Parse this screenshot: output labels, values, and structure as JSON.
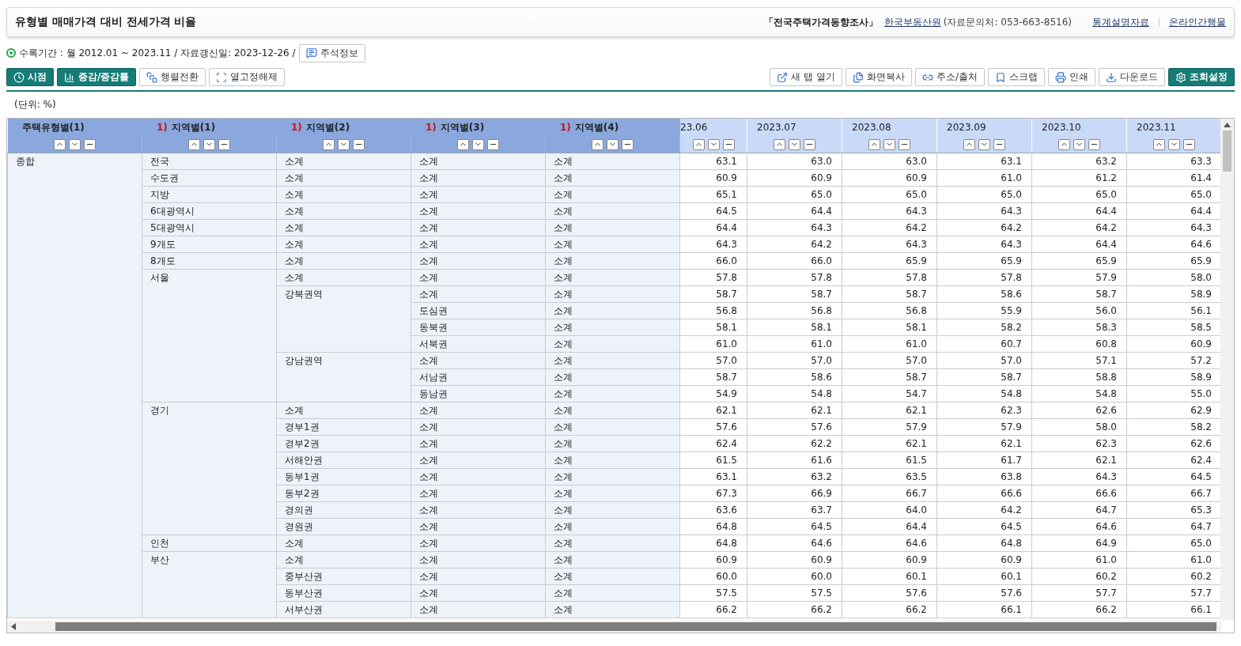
{
  "header": {
    "title": "유형별 매매가격 대비 전세가격 비율",
    "survey": "「전국주택가격동향조사」",
    "agency": "한국부동산원",
    "contact": "(자료문의처: 053-663-8516)",
    "links": [
      "통계설명자료",
      "온라인간행물"
    ]
  },
  "info": {
    "text": "수록기간 : 월 2012.01 ~ 2023.11 / 자료갱신일: 2023-12-26 /",
    "button": "주석정보"
  },
  "toolbar_left": [
    {
      "label": "시점",
      "kind": "primary"
    },
    {
      "label": "증감/증감률",
      "kind": "primary"
    },
    {
      "label": "행렬전환",
      "kind": "plain"
    },
    {
      "label": "열고정해제",
      "kind": "plain"
    }
  ],
  "toolbar_right": [
    {
      "label": "새 탭 열기",
      "kind": "plain"
    },
    {
      "label": "화면복사",
      "kind": "plain"
    },
    {
      "label": "주소/출처",
      "kind": "plain"
    },
    {
      "label": "스크랩",
      "kind": "plain"
    },
    {
      "label": "인쇄",
      "kind": "plain"
    },
    {
      "label": "다운로드",
      "kind": "plain"
    },
    {
      "label": "조회설정",
      "kind": "primary"
    }
  ],
  "unit": "(단위: %)",
  "table": {
    "dim_columns": [
      {
        "label": "주택유형별(1)"
      },
      {
        "mark": "1)",
        "label": "지역별(1)"
      },
      {
        "mark": "1)",
        "label": "지역별(2)"
      },
      {
        "mark": "1)",
        "label": "지역별(3)"
      },
      {
        "mark": "1)",
        "label": "지역별(4)"
      }
    ],
    "value_columns": [
      "23.06",
      "2023.07",
      "2023.08",
      "2023.09",
      "2023.10",
      "2023.11"
    ],
    "groups": [
      {
        "label": "종합",
        "children": [
          {
            "label": "전국",
            "children": [
              {
                "label": "소계",
                "rows": [
                  {
                    "c3": "소계",
                    "c4": "소계",
                    "values": [
                      "63.1",
                      "63.0",
                      "63.0",
                      "63.1",
                      "63.2",
                      "63.3"
                    ]
                  }
                ]
              }
            ]
          },
          {
            "label": "수도권",
            "children": [
              {
                "label": "소계",
                "rows": [
                  {
                    "c3": "소계",
                    "c4": "소계",
                    "values": [
                      "60.9",
                      "60.9",
                      "60.9",
                      "61.0",
                      "61.2",
                      "61.4"
                    ]
                  }
                ]
              }
            ]
          },
          {
            "label": "지방",
            "children": [
              {
                "label": "소계",
                "rows": [
                  {
                    "c3": "소계",
                    "c4": "소계",
                    "values": [
                      "65.1",
                      "65.0",
                      "65.0",
                      "65.0",
                      "65.0",
                      "65.0"
                    ]
                  }
                ]
              }
            ]
          },
          {
            "label": "6대광역시",
            "children": [
              {
                "label": "소계",
                "rows": [
                  {
                    "c3": "소계",
                    "c4": "소계",
                    "values": [
                      "64.5",
                      "64.4",
                      "64.3",
                      "64.3",
                      "64.4",
                      "64.4"
                    ]
                  }
                ]
              }
            ]
          },
          {
            "label": "5대광역시",
            "children": [
              {
                "label": "소계",
                "rows": [
                  {
                    "c3": "소계",
                    "c4": "소계",
                    "values": [
                      "64.4",
                      "64.3",
                      "64.2",
                      "64.2",
                      "64.2",
                      "64.3"
                    ]
                  }
                ]
              }
            ]
          },
          {
            "label": "9개도",
            "children": [
              {
                "label": "소계",
                "rows": [
                  {
                    "c3": "소계",
                    "c4": "소계",
                    "values": [
                      "64.3",
                      "64.2",
                      "64.3",
                      "64.3",
                      "64.4",
                      "64.6"
                    ]
                  }
                ]
              }
            ]
          },
          {
            "label": "8개도",
            "children": [
              {
                "label": "소계",
                "rows": [
                  {
                    "c3": "소계",
                    "c4": "소계",
                    "values": [
                      "66.0",
                      "66.0",
                      "65.9",
                      "65.9",
                      "65.9",
                      "65.9"
                    ]
                  }
                ]
              }
            ]
          },
          {
            "label": "서울",
            "children": [
              {
                "label": "소계",
                "rows": [
                  {
                    "c3": "소계",
                    "c4": "소계",
                    "values": [
                      "57.8",
                      "57.8",
                      "57.8",
                      "57.8",
                      "57.9",
                      "58.0"
                    ]
                  }
                ]
              },
              {
                "label": "강북권역",
                "rows": [
                  {
                    "c3": "소계",
                    "c4": "소계",
                    "values": [
                      "58.7",
                      "58.7",
                      "58.7",
                      "58.6",
                      "58.7",
                      "58.9"
                    ]
                  },
                  {
                    "c3": "도심권",
                    "c4": "소계",
                    "values": [
                      "56.8",
                      "56.8",
                      "56.8",
                      "55.9",
                      "56.0",
                      "56.1"
                    ]
                  },
                  {
                    "c3": "동북권",
                    "c4": "소계",
                    "values": [
                      "58.1",
                      "58.1",
                      "58.1",
                      "58.2",
                      "58.3",
                      "58.5"
                    ]
                  },
                  {
                    "c3": "서북권",
                    "c4": "소계",
                    "values": [
                      "61.0",
                      "61.0",
                      "61.0",
                      "60.7",
                      "60.8",
                      "60.9"
                    ]
                  }
                ]
              },
              {
                "label": "강남권역",
                "rows": [
                  {
                    "c3": "소계",
                    "c4": "소계",
                    "values": [
                      "57.0",
                      "57.0",
                      "57.0",
                      "57.0",
                      "57.1",
                      "57.2"
                    ]
                  },
                  {
                    "c3": "서남권",
                    "c4": "소계",
                    "values": [
                      "58.7",
                      "58.6",
                      "58.7",
                      "58.7",
                      "58.8",
                      "58.9"
                    ]
                  },
                  {
                    "c3": "동남권",
                    "c4": "소계",
                    "values": [
                      "54.9",
                      "54.8",
                      "54.7",
                      "54.8",
                      "54.8",
                      "55.0"
                    ]
                  }
                ]
              }
            ]
          },
          {
            "label": "경기",
            "children": [
              {
                "label": "소계",
                "rows": [
                  {
                    "c3": "소계",
                    "c4": "소계",
                    "values": [
                      "62.1",
                      "62.1",
                      "62.1",
                      "62.3",
                      "62.6",
                      "62.9"
                    ]
                  }
                ]
              },
              {
                "label": "경부1권",
                "rows": [
                  {
                    "c3": "소계",
                    "c4": "소계",
                    "values": [
                      "57.6",
                      "57.6",
                      "57.9",
                      "57.9",
                      "58.0",
                      "58.2"
                    ]
                  }
                ]
              },
              {
                "label": "경부2권",
                "rows": [
                  {
                    "c3": "소계",
                    "c4": "소계",
                    "values": [
                      "62.4",
                      "62.2",
                      "62.1",
                      "62.1",
                      "62.3",
                      "62.6"
                    ]
                  }
                ]
              },
              {
                "label": "서해안권",
                "rows": [
                  {
                    "c3": "소계",
                    "c4": "소계",
                    "values": [
                      "61.5",
                      "61.6",
                      "61.5",
                      "61.7",
                      "62.1",
                      "62.4"
                    ]
                  }
                ]
              },
              {
                "label": "동부1권",
                "rows": [
                  {
                    "c3": "소계",
                    "c4": "소계",
                    "values": [
                      "63.1",
                      "63.2",
                      "63.5",
                      "63.8",
                      "64.3",
                      "64.5"
                    ]
                  }
                ]
              },
              {
                "label": "동부2권",
                "rows": [
                  {
                    "c3": "소계",
                    "c4": "소계",
                    "values": [
                      "67.3",
                      "66.9",
                      "66.7",
                      "66.6",
                      "66.6",
                      "66.7"
                    ]
                  }
                ]
              },
              {
                "label": "경의권",
                "rows": [
                  {
                    "c3": "소계",
                    "c4": "소계",
                    "values": [
                      "63.6",
                      "63.7",
                      "64.0",
                      "64.2",
                      "64.7",
                      "65.3"
                    ]
                  }
                ]
              },
              {
                "label": "경원권",
                "rows": [
                  {
                    "c3": "소계",
                    "c4": "소계",
                    "values": [
                      "64.8",
                      "64.5",
                      "64.4",
                      "64.5",
                      "64.6",
                      "64.7"
                    ]
                  }
                ]
              }
            ]
          },
          {
            "label": "인천",
            "children": [
              {
                "label": "소계",
                "rows": [
                  {
                    "c3": "소계",
                    "c4": "소계",
                    "values": [
                      "64.8",
                      "64.6",
                      "64.6",
                      "64.8",
                      "64.9",
                      "65.0"
                    ]
                  }
                ]
              }
            ]
          },
          {
            "label": "부산",
            "children": [
              {
                "label": "소계",
                "rows": [
                  {
                    "c3": "소계",
                    "c4": "소계",
                    "values": [
                      "60.9",
                      "60.9",
                      "60.9",
                      "60.9",
                      "61.0",
                      "61.0"
                    ]
                  }
                ]
              },
              {
                "label": "중부산권",
                "rows": [
                  {
                    "c3": "소계",
                    "c4": "소계",
                    "values": [
                      "60.0",
                      "60.0",
                      "60.1",
                      "60.1",
                      "60.2",
                      "60.2"
                    ]
                  }
                ]
              },
              {
                "label": "동부산권",
                "rows": [
                  {
                    "c3": "소계",
                    "c4": "소계",
                    "values": [
                      "57.5",
                      "57.5",
                      "57.6",
                      "57.6",
                      "57.7",
                      "57.7"
                    ]
                  }
                ]
              },
              {
                "label": "서부산권",
                "rows": [
                  {
                    "c3": "소계",
                    "c4": "소계",
                    "values": [
                      "66.2",
                      "66.2",
                      "66.2",
                      "66.1",
                      "66.2",
                      "66.1"
                    ]
                  }
                ]
              }
            ]
          }
        ]
      }
    ]
  }
}
